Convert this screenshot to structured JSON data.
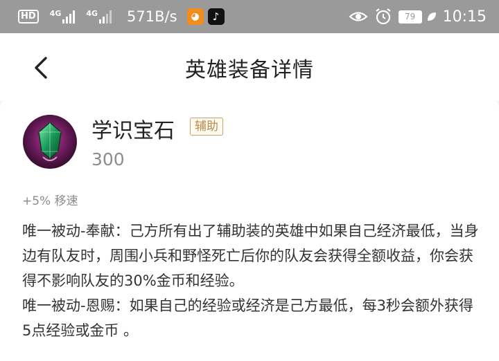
{
  "status_bar": {
    "hd": "HD",
    "sim1_label": "4G",
    "sim2_label": "4G",
    "speed": "571B/s",
    "battery": "79",
    "time": "10:15",
    "icons": [
      "hd-icon",
      "signal-icon",
      "signal-icon",
      "uc-browser-icon",
      "tiktok-icon",
      "eye-icon",
      "alarm-icon",
      "battery-icon",
      "leaf-icon"
    ]
  },
  "header": {
    "title": "英雄装备详情",
    "back_icon": "chevron-left-icon"
  },
  "item": {
    "name": "学识宝石",
    "tag": "辅助",
    "price": "300",
    "attribute": "+5% 移速",
    "passive_1": "唯一被动-奉献：己方所有出了辅助装的英雄中如果自己经济最低，当身边有队友时，周围小兵和野怪死亡后你的队友会获得全额收益，你会获得不影响队友的30%金币和经验。",
    "passive_2": "唯一被动-恩赐：如果自己的经验或经济是己方最低，每3秒会额外获得5点经验或金币 。"
  },
  "colors": {
    "status_bar_bg": "#9a9a9a",
    "tag_border": "#c8a26a",
    "tag_text": "#b88a4a"
  }
}
